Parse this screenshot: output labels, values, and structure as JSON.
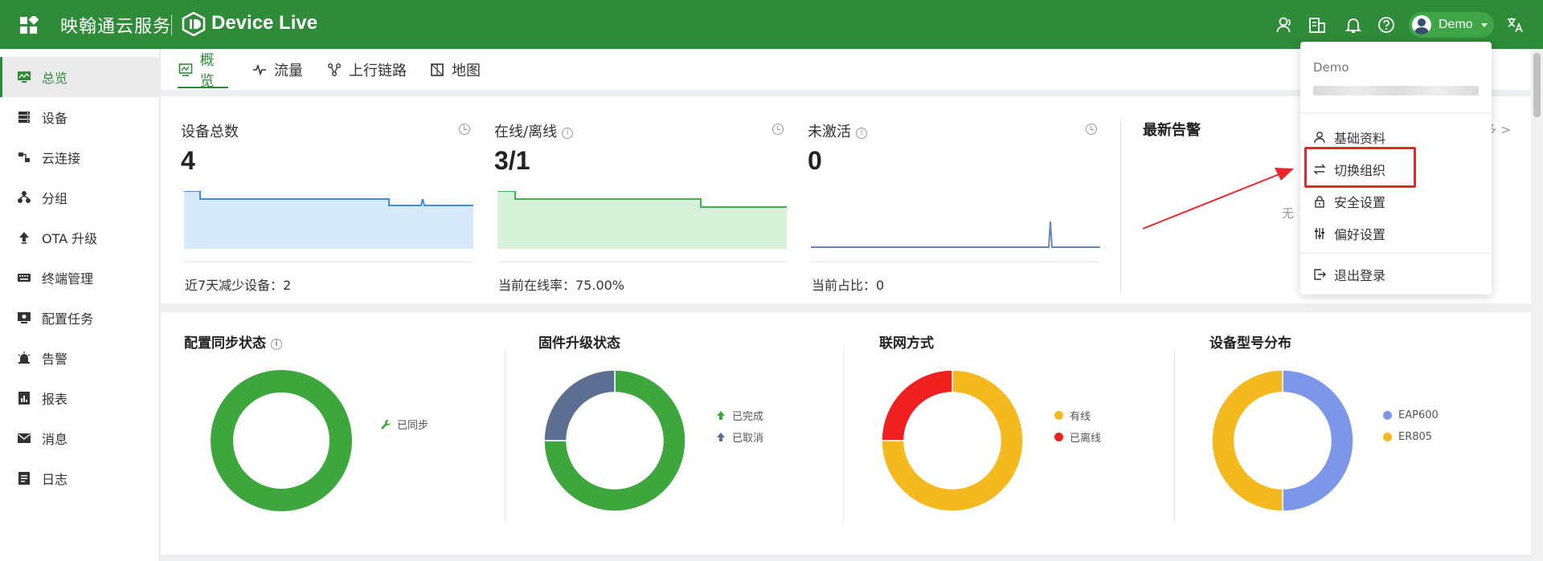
{
  "header": {
    "brand": "映翰通云服务",
    "product": "Device Live",
    "user_name": "Demo"
  },
  "sidebar": {
    "items": [
      {
        "label": "总览",
        "icon": "monitor-icon"
      },
      {
        "label": "设备",
        "icon": "server-icon"
      },
      {
        "label": "云连接",
        "icon": "link-icon"
      },
      {
        "label": "分组",
        "icon": "group-icon"
      },
      {
        "label": "OTA 升级",
        "icon": "upload-icon"
      },
      {
        "label": "终端管理",
        "icon": "keyboard-icon"
      },
      {
        "label": "配置任务",
        "icon": "config-icon"
      },
      {
        "label": "告警",
        "icon": "alarm-icon"
      },
      {
        "label": "报表",
        "icon": "report-icon"
      },
      {
        "label": "消息",
        "icon": "mail-icon"
      },
      {
        "label": "日志",
        "icon": "log-icon"
      }
    ]
  },
  "tabs": [
    {
      "label": "概览",
      "icon": "overview-icon"
    },
    {
      "label": "流量",
      "icon": "pulse-icon"
    },
    {
      "label": "上行链路",
      "icon": "nodes-icon"
    },
    {
      "label": "地图",
      "icon": "map-icon"
    }
  ],
  "metrics": [
    {
      "title": "设备总数",
      "value": "4",
      "footer": "近7天减少设备：2",
      "color": "#3a8ee6",
      "fill": "#d7eafb"
    },
    {
      "title": "在线/离线",
      "value": "3/1",
      "footer": "当前在线率：75.00%",
      "color": "#3bb54a",
      "fill": "#d8f1db"
    },
    {
      "title": "未激活",
      "value": "0",
      "footer": "当前占比：0",
      "color": "#6a86b8",
      "fill": "none"
    }
  ],
  "alarms": {
    "title": "最新告警",
    "more": "更多 >",
    "empty": "无"
  },
  "donuts": [
    {
      "title": "配置同步状态",
      "info": true
    },
    {
      "title": "固件升级状态",
      "info": false
    },
    {
      "title": "联网方式",
      "info": false
    },
    {
      "title": "设备型号分布",
      "info": false
    }
  ],
  "chart_data": [
    {
      "type": "pie",
      "title": "配置同步状态",
      "labels": [
        "已同步"
      ],
      "values": [
        1
      ],
      "colors": [
        "#3da63c"
      ]
    },
    {
      "type": "pie",
      "title": "固件升级状态",
      "labels": [
        "已完成",
        "已取消"
      ],
      "values": [
        3,
        1
      ],
      "colors": [
        "#3da63c",
        "#5c6f92"
      ]
    },
    {
      "type": "pie",
      "title": "联网方式",
      "labels": [
        "有线",
        "已离线"
      ],
      "values": [
        3,
        1
      ],
      "colors": [
        "#f4b91f",
        "#f02020"
      ]
    },
    {
      "type": "pie",
      "title": "设备型号分布",
      "labels": [
        "EAP600",
        "ER805"
      ],
      "values": [
        1,
        1
      ],
      "colors": [
        "#7d97e8",
        "#f4b91f"
      ]
    }
  ],
  "dropdown": {
    "org_name": "Demo",
    "items": [
      {
        "label": "基础资料",
        "icon": "person-icon"
      },
      {
        "label": "切换组织",
        "icon": "switch-icon"
      },
      {
        "label": "安全设置",
        "icon": "lock-icon"
      },
      {
        "label": "偏好设置",
        "icon": "sliders-icon"
      },
      {
        "label": "退出登录",
        "icon": "logout-icon"
      }
    ]
  },
  "colors": {
    "brand_green": "#2e8b37",
    "annotation_red": "#e8262a"
  }
}
